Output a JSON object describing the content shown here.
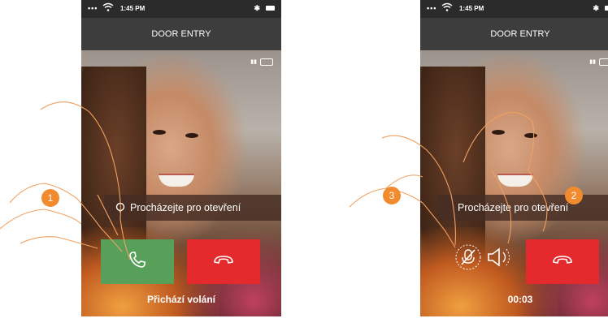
{
  "screens": [
    {
      "status": {
        "dots": "•••",
        "time": "1:45 PM",
        "bt": "✱"
      },
      "title": "DOOR ENTRY",
      "slide_text": "Procházejte pro otevření",
      "caption": "Přichází volání",
      "badges": [
        "1"
      ]
    },
    {
      "status": {
        "dots": "•••",
        "time": "1:45 PM",
        "bt": "✱"
      },
      "title": "DOOR ENTRY",
      "slide_text": "Procházejte pro otevření",
      "caption": "00:03",
      "badges": [
        "3",
        "2"
      ]
    }
  ],
  "colors": {
    "accept": "#58a05a",
    "reject": "#e52a2d",
    "badge": "#f28a2e",
    "header": "#3d3d3d"
  },
  "icons": [
    "wifi-icon",
    "bluetooth-icon",
    "battery-icon",
    "lock-icon",
    "phone-handset-icon",
    "hang-up-icon",
    "mic-muted-icon",
    "speaker-icon"
  ]
}
